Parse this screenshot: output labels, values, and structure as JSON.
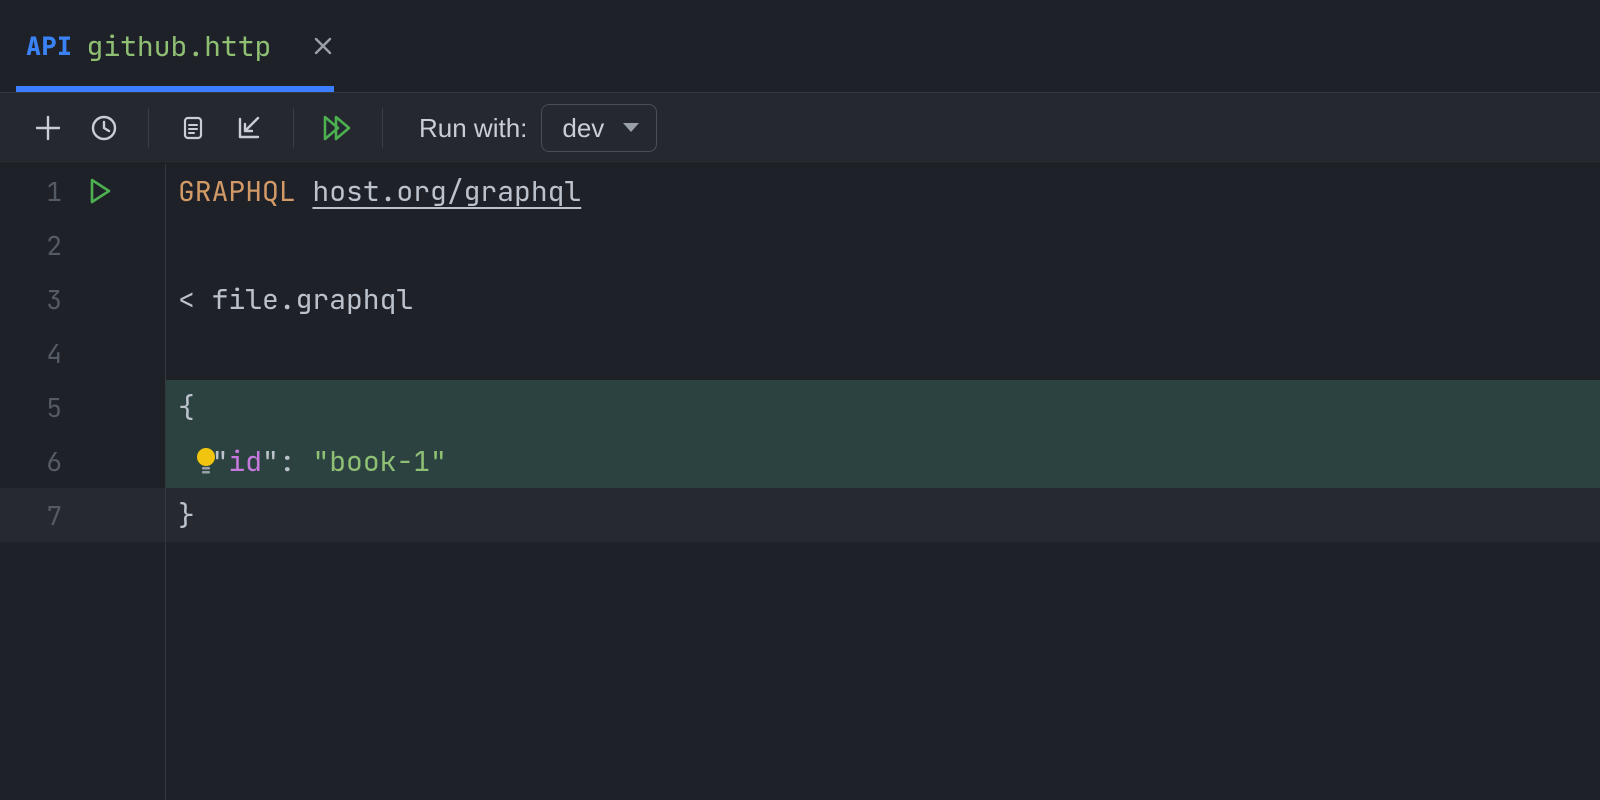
{
  "tab": {
    "api_label": "API",
    "filename": "github.http"
  },
  "toolbar": {
    "run_with_label": "Run with:",
    "environment": "dev"
  },
  "gutter": {
    "line_numbers": [
      "1",
      "2",
      "3",
      "4",
      "5",
      "6",
      "7"
    ]
  },
  "code": {
    "method": "GRAPHQL",
    "url": "host.org/graphql",
    "include_file": "< file.graphql",
    "brace_open": "{",
    "json_key_quote": "\"",
    "json_key": "id",
    "json_colon": ": ",
    "json_value": "\"book-1\"",
    "brace_close": "}"
  }
}
